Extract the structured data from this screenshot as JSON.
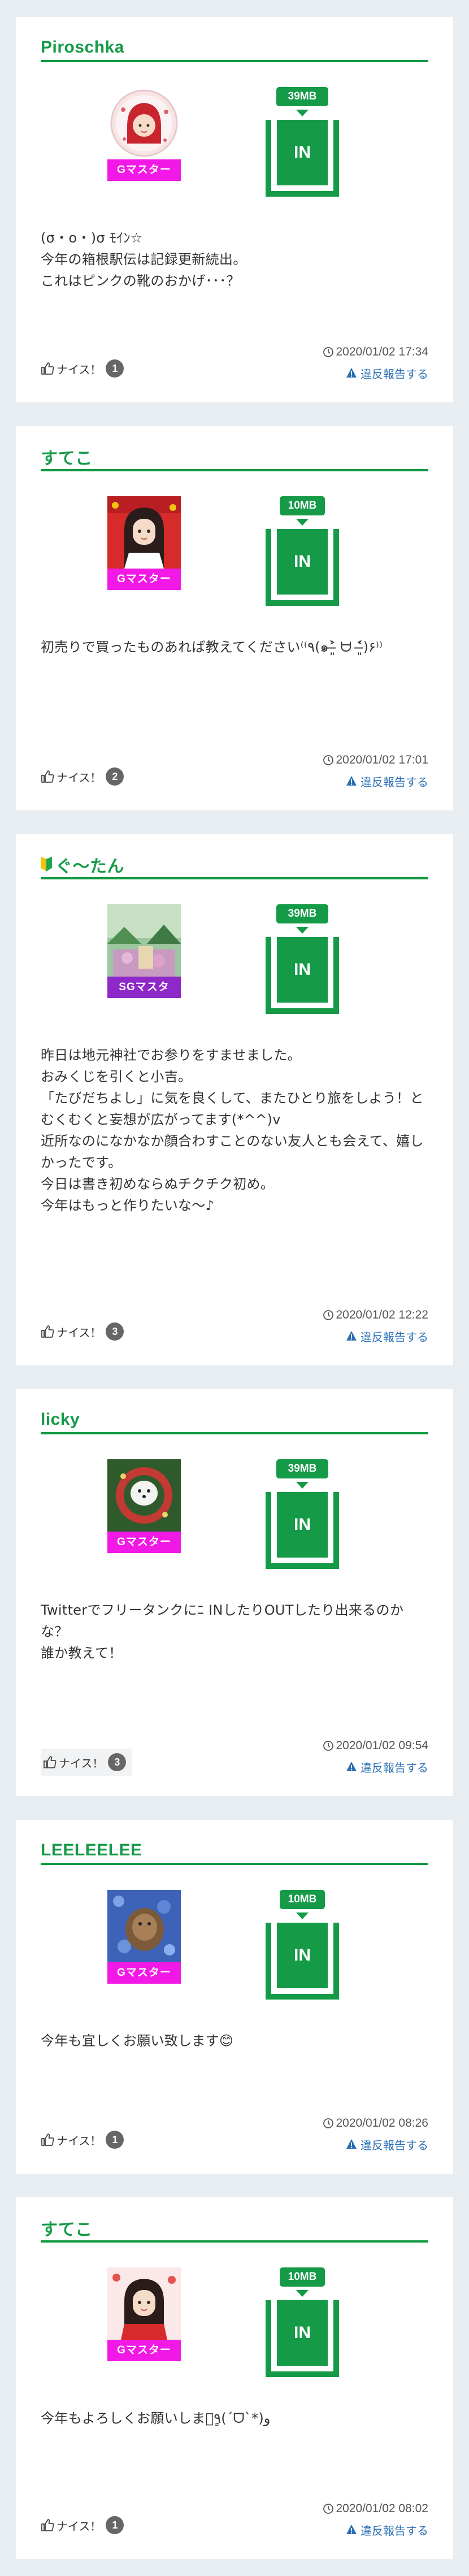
{
  "common": {
    "nice_label": "ナイス！",
    "report_label": "違反報告する",
    "in_label": "IN"
  },
  "posts": [
    {
      "username": "Piroschka",
      "beginner": false,
      "rank": "Gマスター",
      "size": "39MB",
      "body": "(σ・o・)σ ﾓｲﾝ☆\n今年の箱根駅伝は記録更新続出。\nこれはピンクの靴のおかげ･･･？",
      "nice_count": "1",
      "timestamp": "2020/01/02 17:34"
    },
    {
      "username": "すてこ",
      "beginner": false,
      "rank": "Gマスター",
      "size": "10MB",
      "body": "初売りで買ったものあれば教えてください⁽⁽٩(๑˃̶͈̀ ᗨ ˂̶͈́)۶⁾⁾",
      "nice_count": "2",
      "timestamp": "2020/01/02 17:01"
    },
    {
      "username": "ぐ〜たん",
      "beginner": true,
      "rank": "SGマスタ",
      "size": "39MB",
      "body": "昨日は地元神社でお参りをすませました。\nおみくじを引くと小吉。\n「たびだちよし」に気を良くして、またひとり旅をしよう！とむくむくと妄想が広がってます(*^^)v\n近所なのになかなか顔合わすことのない友人とも会えて、嬉しかったです。\n今日は書き初めならぬチクチク初め。\n今年はもっと作りたいな〜♪",
      "nice_count": "3",
      "timestamp": "2020/01/02 12:22"
    },
    {
      "username": "licky",
      "beginner": false,
      "rank": "Gマスター",
      "size": "39MB",
      "body": "Twitterでフリータンクにﾆ INしたりOUTしたり出来るのかな？\n誰か教えて！",
      "nice_count": "3",
      "timestamp": "2020/01/02 09:54"
    },
    {
      "username": "LEELEELEE",
      "beginner": false,
      "rank": "Gマスター",
      "size": "10MB",
      "body": "今年も宜しくお願い致します😊",
      "nice_count": "1",
      "timestamp": "2020/01/02 08:26"
    },
    {
      "username": "すてこ",
      "beginner": false,
      "rank": "Gマスター",
      "size": "10MB",
      "body": "今年もよろしくお願いしますٍ٩(ˊᗜˋ*)و",
      "nice_count": "1",
      "timestamp": "2020/01/02 08:02"
    }
  ]
}
